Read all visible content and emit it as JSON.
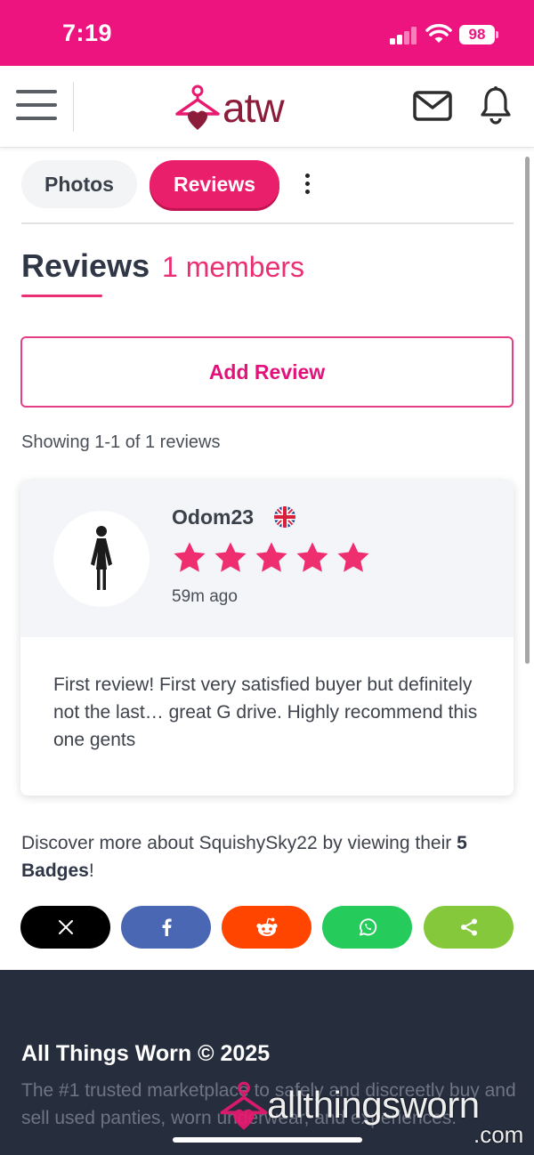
{
  "status_bar": {
    "time": "7:19",
    "battery": "98"
  },
  "header": {
    "logo_text": "atw"
  },
  "tabs": [
    {
      "label": "Photos",
      "active": false
    },
    {
      "label": "Reviews",
      "active": true
    }
  ],
  "reviews_section": {
    "title": "Reviews",
    "count": "1 members",
    "add_review_label": "Add Review",
    "showing_text": "Showing 1-1 of 1 reviews"
  },
  "review": {
    "reviewer": "Odom23",
    "country_flag": "uk-flag-icon",
    "rating": 5,
    "rating_max": 5,
    "time": "59m ago",
    "text": "First review! First very satisfied buyer but definitely not the last… great G drive. Highly recommend this one gents"
  },
  "discover": {
    "prefix": "Discover more about SquishySky22 by viewing their",
    "badges": "5 Badges",
    "suffix": "!"
  },
  "share_buttons": [
    "x-icon",
    "facebook-icon",
    "reddit-icon",
    "whatsapp-icon",
    "share-icon"
  ],
  "footer": {
    "title": "All Things Worn © 2025",
    "text": "The #1 trusted marketplace to safely and discreetly buy and sell used panties, worn underwear, and experiences."
  },
  "watermark": {
    "text": "allthingsworn",
    "suffix": ".com"
  },
  "colors": {
    "brand_pink": "#ee1480",
    "accent": "#ea1f6b",
    "footer_bg": "#262d3d",
    "star": "#ee2e6f"
  }
}
